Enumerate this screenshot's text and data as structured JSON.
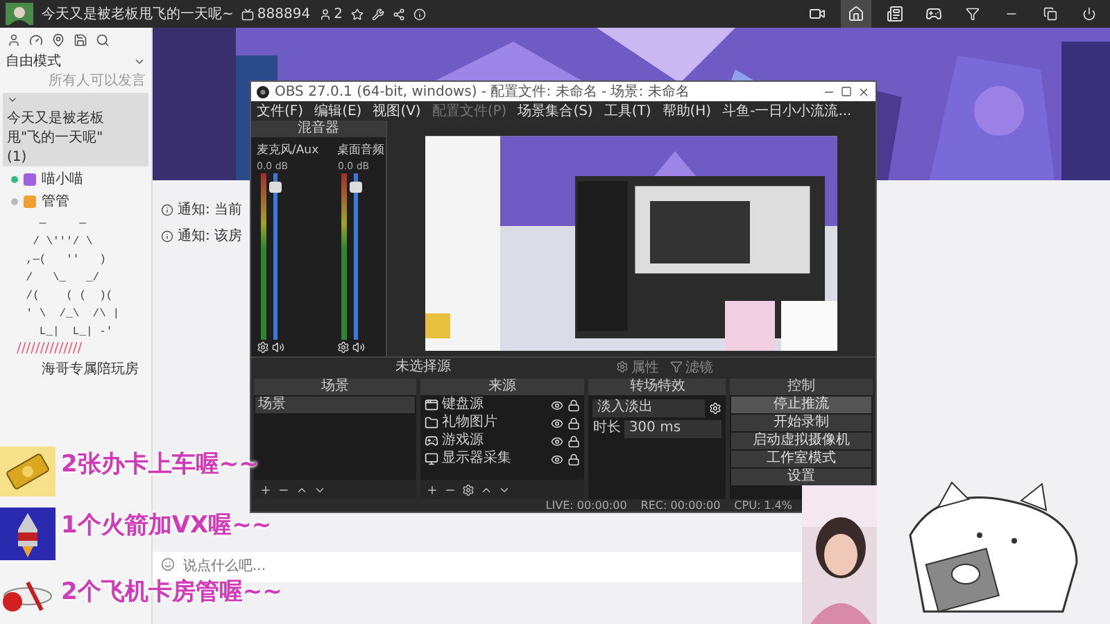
{
  "top_bar": {
    "room_title": "今天又是被老板甩飞的一天呢~",
    "room_id": "888894",
    "online_count": "2"
  },
  "sidebar": {
    "mode": "自由模式",
    "speak_permission": "所有人可以发言",
    "channel": {
      "name": "今天又是被老板甩\"飞的一天呢\"",
      "count": "(1)",
      "expanded": true,
      "members": [
        {
          "name": "喵小喵",
          "online": true,
          "color": "#a060e0"
        },
        {
          "name": "管管",
          "online": false,
          "color": "#f0a030"
        }
      ]
    },
    "ascii_art": [
      "   —     —",
      "  / \\'''/ \\",
      " ,—(   ''   )",
      " /   \\_   _/",
      " /(    ( (  )(",
      " ' \\  /_\\  /\\ |",
      "   L_|  L_| -'"
    ],
    "divider_text": "//////////////",
    "room_link": "海哥专属陪玩房"
  },
  "notices": [
    "通知: 当前",
    "通知: 该房"
  ],
  "chat_input": {
    "placeholder": "说点什么吧..."
  },
  "obs": {
    "title": "OBS 27.0.1 (64-bit, windows) - 配置文件: 未命名 - 场景: 未命名",
    "menu": [
      {
        "label": "文件(F)",
        "disabled": false
      },
      {
        "label": "编辑(E)",
        "disabled": false
      },
      {
        "label": "视图(V)",
        "disabled": false
      },
      {
        "label": "配置文件(P)",
        "disabled": true
      },
      {
        "label": "场景集合(S)",
        "disabled": false
      },
      {
        "label": "工具(T)",
        "disabled": false
      },
      {
        "label": "帮助(H)",
        "disabled": false
      },
      {
        "label": "斗鱼-一日小小流流...",
        "disabled": false
      }
    ],
    "mixer": {
      "title": "混音器",
      "channels": [
        {
          "name": "麦克风/Aux",
          "reading": "0.0 dB",
          "level": 0.95
        },
        {
          "name": "桌面音频",
          "reading": "0.0 dB",
          "level": 0.95
        }
      ]
    },
    "source_bar": {
      "label": "未选择源",
      "buttons": [
        "属性",
        "滤镜"
      ]
    },
    "scenes": {
      "title": "场景",
      "items": [
        {
          "label": "场景",
          "selected": true
        }
      ]
    },
    "sources": {
      "title": "来源",
      "items": [
        {
          "label": "键盘源",
          "kind": "window"
        },
        {
          "label": "礼物图片",
          "kind": "folder"
        },
        {
          "label": "游戏源",
          "kind": "game"
        },
        {
          "label": "显示器采集",
          "kind": "display"
        }
      ]
    },
    "transitions": {
      "title": "转场特效",
      "effect": "淡入淡出",
      "duration_label": "时长",
      "duration": "300 ms"
    },
    "controls": {
      "title": "控制",
      "buttons": [
        {
          "label": "停止推流",
          "selected": true
        },
        {
          "label": "开始录制",
          "selected": false
        },
        {
          "label": "启动虚拟摄像机",
          "selected": false
        },
        {
          "label": "工作室模式",
          "selected": false
        },
        {
          "label": "设置",
          "selected": false
        }
      ]
    },
    "status": {
      "live": "LIVE: 00:00:00",
      "rec": "REC: 00:00:00",
      "cpu": "CPU: 1.4%"
    }
  },
  "gifts": [
    {
      "text": "2张办卡上车喔~~",
      "kind": "card"
    },
    {
      "text": "1个火箭加VX喔~~",
      "kind": "rocket"
    },
    {
      "text": "2个飞机卡房管喔~~",
      "kind": "plane"
    }
  ]
}
